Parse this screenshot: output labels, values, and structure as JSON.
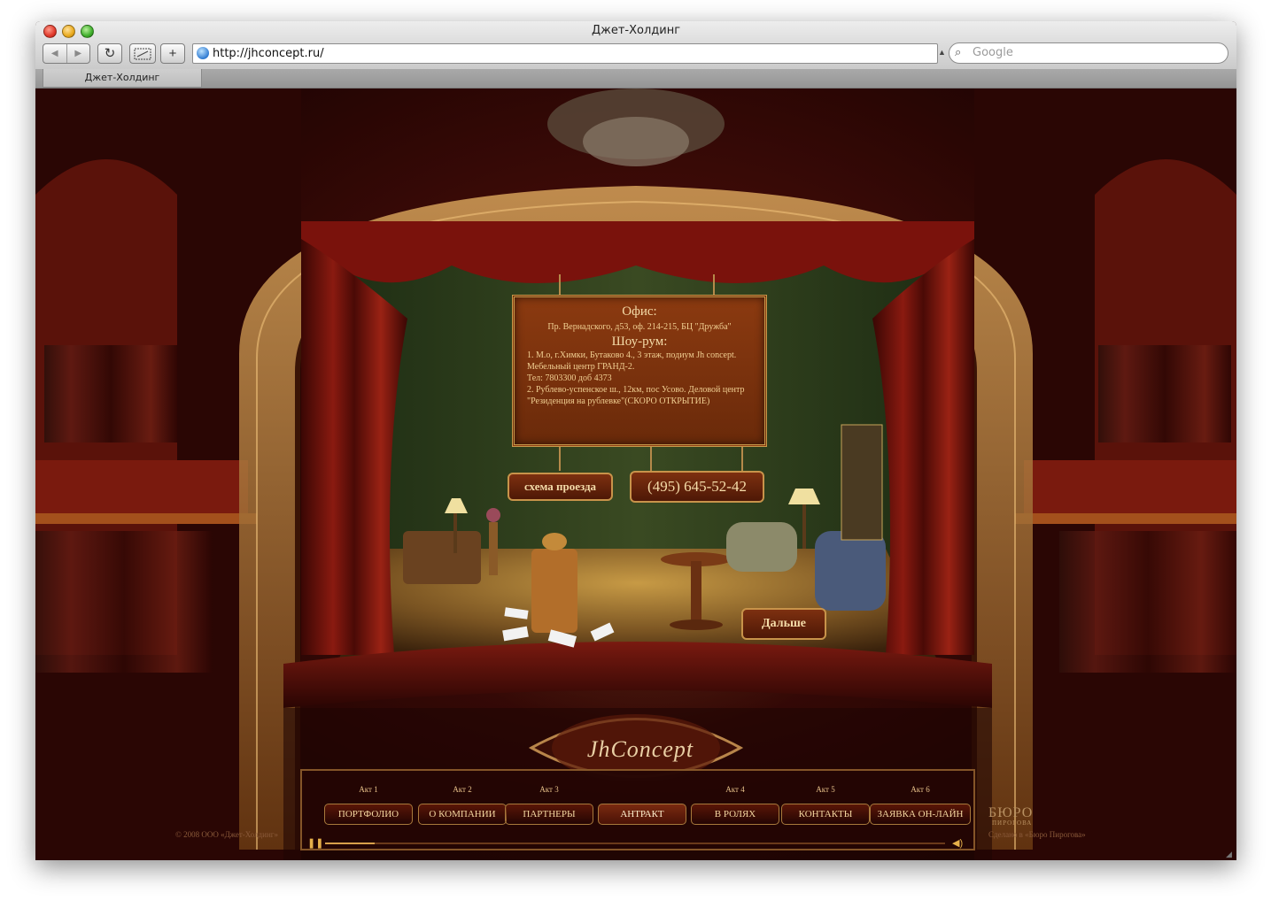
{
  "window": {
    "title": "Джет-Холдинг"
  },
  "toolbar": {
    "back_icon": "back-icon",
    "forward_icon": "forward-icon",
    "reload_icon": "reload-icon",
    "snippet_icon": "snippet-icon",
    "add_label": "+",
    "url": "http://jhconcept.ru/",
    "search_placeholder": "Google"
  },
  "tabs": [
    {
      "label": "Джет-Холдинг"
    }
  ],
  "colors": {
    "accent": "#c8934a",
    "stage_red": "#5a130c",
    "panel_bg": "#7d3010",
    "text_gold": "#f5dca9"
  },
  "info": {
    "office_title": "Офис:",
    "office_address": "Пр. Вернадского, д53, оф. 214-215, БЦ \"Дружба\"",
    "showroom_title": "Шоу-рум:",
    "showroom_1": "1. М.о, г.Химки, Бутаково 4., 3 этаж, подиум Jh concept. Мебельный центр ГРАНД-2.",
    "showroom_phone": "Тел: 7803300 доб 4373",
    "showroom_2": "2. Рублево-успенское ш., 12км, пос Усово. Деловой центр \"Резиденция на рублевке\"(СКОРО ОТКРЫТИЕ)"
  },
  "buttons": {
    "route": "схема проезда",
    "phone": "(495)  645-52-42",
    "next": "Дальше"
  },
  "logo": {
    "text": "JhConcept"
  },
  "nav": [
    {
      "act": "Акт 1",
      "label": "ПОРТФОЛИО"
    },
    {
      "act": "Акт 2",
      "label": "О КОМПАНИИ"
    },
    {
      "act": "Акт 3",
      "label": "ПАРТНЕРЫ"
    },
    {
      "act": "",
      "label": "АНТРАКТ"
    },
    {
      "act": "Акт 4",
      "label": "В РОЛЯХ"
    },
    {
      "act": "Акт 5",
      "label": "КОНТАКТЫ"
    },
    {
      "act": "Акт 6",
      "label": "ЗАЯВКА ОН-ЛАЙН"
    }
  ],
  "footer": {
    "copyright": "© 2008 ООО «Джет-Холдинг»",
    "buro": "БЮРО",
    "buro_sub": "ПИРОГОВА",
    "made_by": "Сделано в «Бюро Пирогова»"
  },
  "player": {
    "progress": 0.08
  }
}
